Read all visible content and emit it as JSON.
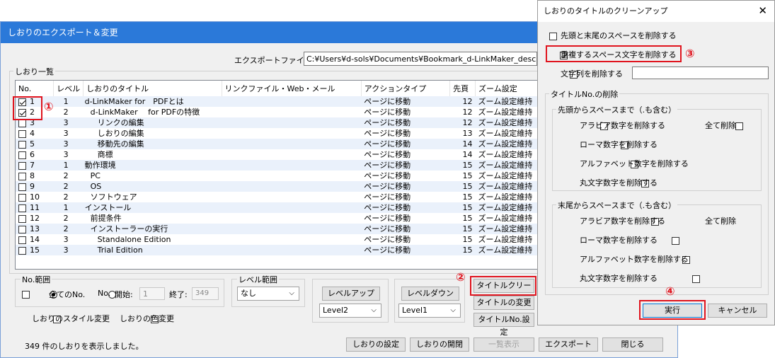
{
  "main_window": {
    "title": "しおりのエクスポート＆変更",
    "export_file_label": "エクスポートファイル:",
    "export_file_value": "C:¥Users¥d-sols¥Documents¥Bookmark_d-LinkMaker_descriptio",
    "list_group_label": "しおり一覧",
    "columns": [
      "No.",
      "レベル",
      "しおりのタイトル",
      "リンクファイル・Web・メール",
      "アクションタイプ",
      "先頁",
      "ズーム設定"
    ],
    "rows": [
      {
        "checked": true,
        "no": "1",
        "level": "1",
        "title": "d-LinkMaker for　PDFとは",
        "link": "",
        "action": "ページに移動",
        "page": "12",
        "zoom": "ズーム設定維持"
      },
      {
        "checked": true,
        "no": "2",
        "level": "2",
        "title": "d-LinkMaker　 for PDFの特徴",
        "link": "",
        "action": "ページに移動",
        "page": "12",
        "zoom": "ズーム設定維持"
      },
      {
        "checked": false,
        "no": "3",
        "level": "3",
        "title": "リンクの編集",
        "link": "",
        "action": "ページに移動",
        "page": "12",
        "zoom": "ズーム設定維持"
      },
      {
        "checked": false,
        "no": "4",
        "level": "3",
        "title": "しおりの編集",
        "link": "",
        "action": "ページに移動",
        "page": "13",
        "zoom": "ズーム設定維持"
      },
      {
        "checked": false,
        "no": "5",
        "level": "3",
        "title": "移動先の編集",
        "link": "",
        "action": "ページに移動",
        "page": "14",
        "zoom": "ズーム設定維持"
      },
      {
        "checked": false,
        "no": "6",
        "level": "3",
        "title": "商標",
        "link": "",
        "action": "ページに移動",
        "page": "14",
        "zoom": "ズーム設定維持"
      },
      {
        "checked": false,
        "no": "7",
        "level": "1",
        "title": "動作環境",
        "link": "",
        "action": "ページに移動",
        "page": "15",
        "zoom": "ズーム設定維持"
      },
      {
        "checked": false,
        "no": "8",
        "level": "2",
        "title": "PC",
        "link": "",
        "action": "ページに移動",
        "page": "15",
        "zoom": "ズーム設定維持"
      },
      {
        "checked": false,
        "no": "9",
        "level": "2",
        "title": "OS",
        "link": "",
        "action": "ページに移動",
        "page": "15",
        "zoom": "ズーム設定維持"
      },
      {
        "checked": false,
        "no": "10",
        "level": "2",
        "title": "ソフトウェア",
        "link": "",
        "action": "ページに移動",
        "page": "15",
        "zoom": "ズーム設定維持"
      },
      {
        "checked": false,
        "no": "11",
        "level": "1",
        "title": "インストール",
        "link": "",
        "action": "ページに移動",
        "page": "15",
        "zoom": "ズーム設定維持"
      },
      {
        "checked": false,
        "no": "12",
        "level": "2",
        "title": "前提条件",
        "link": "",
        "action": "ページに移動",
        "page": "15",
        "zoom": "ズーム設定維持"
      },
      {
        "checked": false,
        "no": "13",
        "level": "2",
        "title": "インストーラーの実行",
        "link": "",
        "action": "ページに移動",
        "page": "15",
        "zoom": "ズーム設定維持"
      },
      {
        "checked": false,
        "no": "14",
        "level": "3",
        "title": "Standalone Edition",
        "link": "",
        "action": "ページに移動",
        "page": "15",
        "zoom": "ズーム設定維持"
      },
      {
        "checked": false,
        "no": "15",
        "level": "3",
        "title": "Trial Edition",
        "link": "",
        "action": "ページに移動",
        "page": "15",
        "zoom": "ズーム設定維持"
      }
    ],
    "no_range": {
      "label": "No.範囲",
      "all_label": "全てのNo.",
      "no_label": "No.",
      "start_label": "開始:",
      "start_value": "1",
      "end_label": "終了:",
      "end_value": "349"
    },
    "level_range": {
      "label": "レベル範囲",
      "value": "なし"
    },
    "level_up": {
      "label": "レベルアップ",
      "select": "Level2"
    },
    "level_down": {
      "label": "レベルダウン",
      "select": "Level1"
    },
    "title_clean_button": "タイトルクリーン",
    "title_change_button": "タイトルの変更",
    "title_no_button": "タイトルNo.設定",
    "style_change_label": "しおりのスタイル変更",
    "color_change_label": "しおりの色変更",
    "status_text": "349 件のしおりを表示しました。",
    "footer_buttons": {
      "settings": "しおりの設定",
      "open_close": "しおりの開閉",
      "list_view": "一覧表示",
      "export": "エクスポート",
      "close": "閉じる"
    }
  },
  "dialog": {
    "title": "しおりのタイトルのクリーンアップ",
    "opt_trim": "先頭と末尾のスペースを削除する",
    "opt_dup": "重複するスペース文字を削除する",
    "opt_dup_checked": true,
    "opt_string": "文字列を削除する",
    "title_no_group": "タイトルNo.の削除",
    "head_group": "先頭からスペースまで（.も含む）",
    "tail_group": "末尾からスペースまで（.も含む）",
    "arabic": "アラビア数字を削除する",
    "roman": "ローマ数字を削除する",
    "alpha": "アルファベット数字を削除する",
    "circled": "丸文字数字を削除する",
    "all_delete": "全て削除",
    "execute": "実行",
    "cancel": "キャンセル"
  },
  "markers": [
    "①",
    "②",
    "③",
    "④"
  ],
  "colors": {
    "accent": "#2b79d9",
    "marker": "#e0141e",
    "row_alt": "#eaf1fb"
  }
}
